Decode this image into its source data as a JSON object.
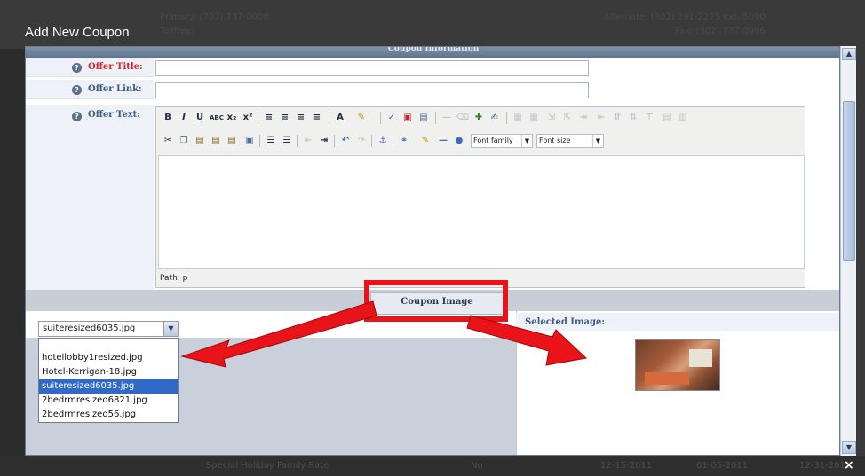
{
  "background": {
    "primary": "Primary: (702) 737-0000",
    "tollfree": "Tollfree:",
    "alternate": "Alternate: (302) 291-2275 ext. 5090",
    "fax": "Fax: (302) 737-0996",
    "bottom_row": {
      "name": "Special Holiday Family Rate",
      "col2": "No",
      "date1": "12-15-2011",
      "date2": "01-05-2011",
      "date3": "12-31-2011"
    }
  },
  "modal": {
    "title": "Add New Coupon",
    "section_title": "Coupon Information",
    "close_glyph": "×",
    "fields": {
      "offer_title_label": "Offer Title:",
      "offer_title_value": "",
      "offer_link_label": "Offer Link:",
      "offer_link_value": "",
      "offer_text_label": "Offer Text:"
    },
    "editor": {
      "font_family": "Font family",
      "font_size": "Font size",
      "path": "Path: p"
    },
    "coupon_image": {
      "header": "Coupon Image",
      "selected_file": "suiteresized6035.jpg",
      "options": [
        "hotellobby1resized.jpg",
        "Hotel-Kerrigan-18.jpg",
        "suiteresized6035.jpg",
        "2bedrmresized6821.jpg",
        "2bedrmresized56.jpg"
      ],
      "selected_index": 2,
      "selected_image_label": "Selected Image:"
    }
  },
  "annotation": {
    "box_color": "#e8141a",
    "arrow_color": "#e8141a"
  },
  "colors": {
    "header_blue": "#5f7290",
    "label_blue": "#3d5a80",
    "required_red": "#d12a2a",
    "selection_blue": "#3169c6"
  }
}
